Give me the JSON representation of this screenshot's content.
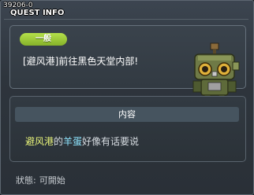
{
  "window": {
    "quest_id": "39206-0",
    "title": "QUEST INFO"
  },
  "quest": {
    "category_badge": "一般",
    "name": "[避风港]前往黑色天堂内部!",
    "npc_portrait": "robot-npc-icon"
  },
  "content": {
    "header": "内容",
    "description": {
      "location": "避风港",
      "part1": "的",
      "npc": "羊蛋",
      "part2": "好像有话要说"
    }
  },
  "status": {
    "label": "狀態:",
    "value": "可開始"
  },
  "colors": {
    "badge_green": "#a4d03e",
    "location_yellow": "#e6f279",
    "npc_cyan": "#8fe6ff"
  }
}
